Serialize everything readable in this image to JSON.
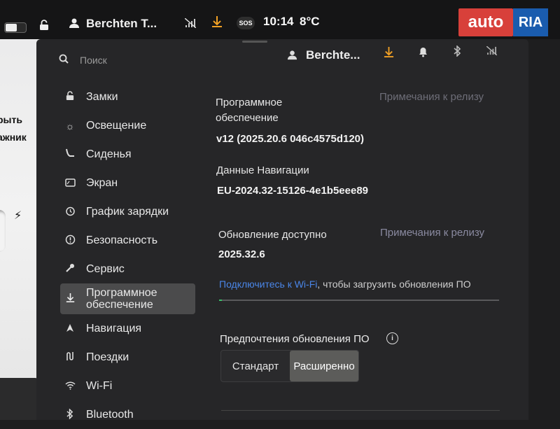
{
  "status_bar": {
    "user_name": "Berchten T...",
    "time": "10:14",
    "temperature": "8°C",
    "sos_label": "SOS"
  },
  "left_view": {
    "text_fragment_1": "рыть",
    "text_fragment_2": "ажник"
  },
  "watermark": {
    "auto": "auto",
    "ria": "RIA"
  },
  "header": {
    "search_placeholder": "Поиск",
    "user_name": "Berchte..."
  },
  "sidebar": {
    "items": [
      {
        "label": "Замки",
        "icon": "lock-icon"
      },
      {
        "label": "Освещение",
        "icon": "light-icon"
      },
      {
        "label": "Сиденья",
        "icon": "seat-icon"
      },
      {
        "label": "Экран",
        "icon": "display-icon"
      },
      {
        "label": "График зарядки",
        "icon": "clock-icon"
      },
      {
        "label": "Безопасность",
        "icon": "alert-icon"
      },
      {
        "label": "Сервис",
        "icon": "wrench-icon"
      },
      {
        "label": "Программное обеспечение",
        "icon": "download-icon",
        "active": true
      },
      {
        "label": "Навигация",
        "icon": "navigation-icon"
      },
      {
        "label": "Поездки",
        "icon": "trips-icon"
      },
      {
        "label": "Wi-Fi",
        "icon": "wifi-icon"
      },
      {
        "label": "Bluetooth",
        "icon": "bluetooth-icon"
      }
    ]
  },
  "software": {
    "label": "Программное обеспечение",
    "release_notes": "Примечания к релизу",
    "version": "v12 (2025.20.6 046c4575d120)",
    "nav_data_label": "Данные Навигации",
    "nav_data_value": "EU-2024.32-15126-4e1b5eee89",
    "update_label": "Обновление доступно",
    "update_release_notes": "Примечания к релизу",
    "update_version": "2025.32.6",
    "wifi_link": "Подключитесь к Wi-Fi",
    "wifi_rest": ", чтобы загрузить обновления ПО",
    "progress_percent": 1,
    "prefs_label": "Предпочтения обновления ПО",
    "options": [
      "Стандарт",
      "Расширенно"
    ],
    "selected_option": "Расширенно"
  },
  "colors": {
    "accent_download": "#f0a025",
    "link": "#4a86e8",
    "progress": "#39c26a",
    "background": "#262628"
  }
}
